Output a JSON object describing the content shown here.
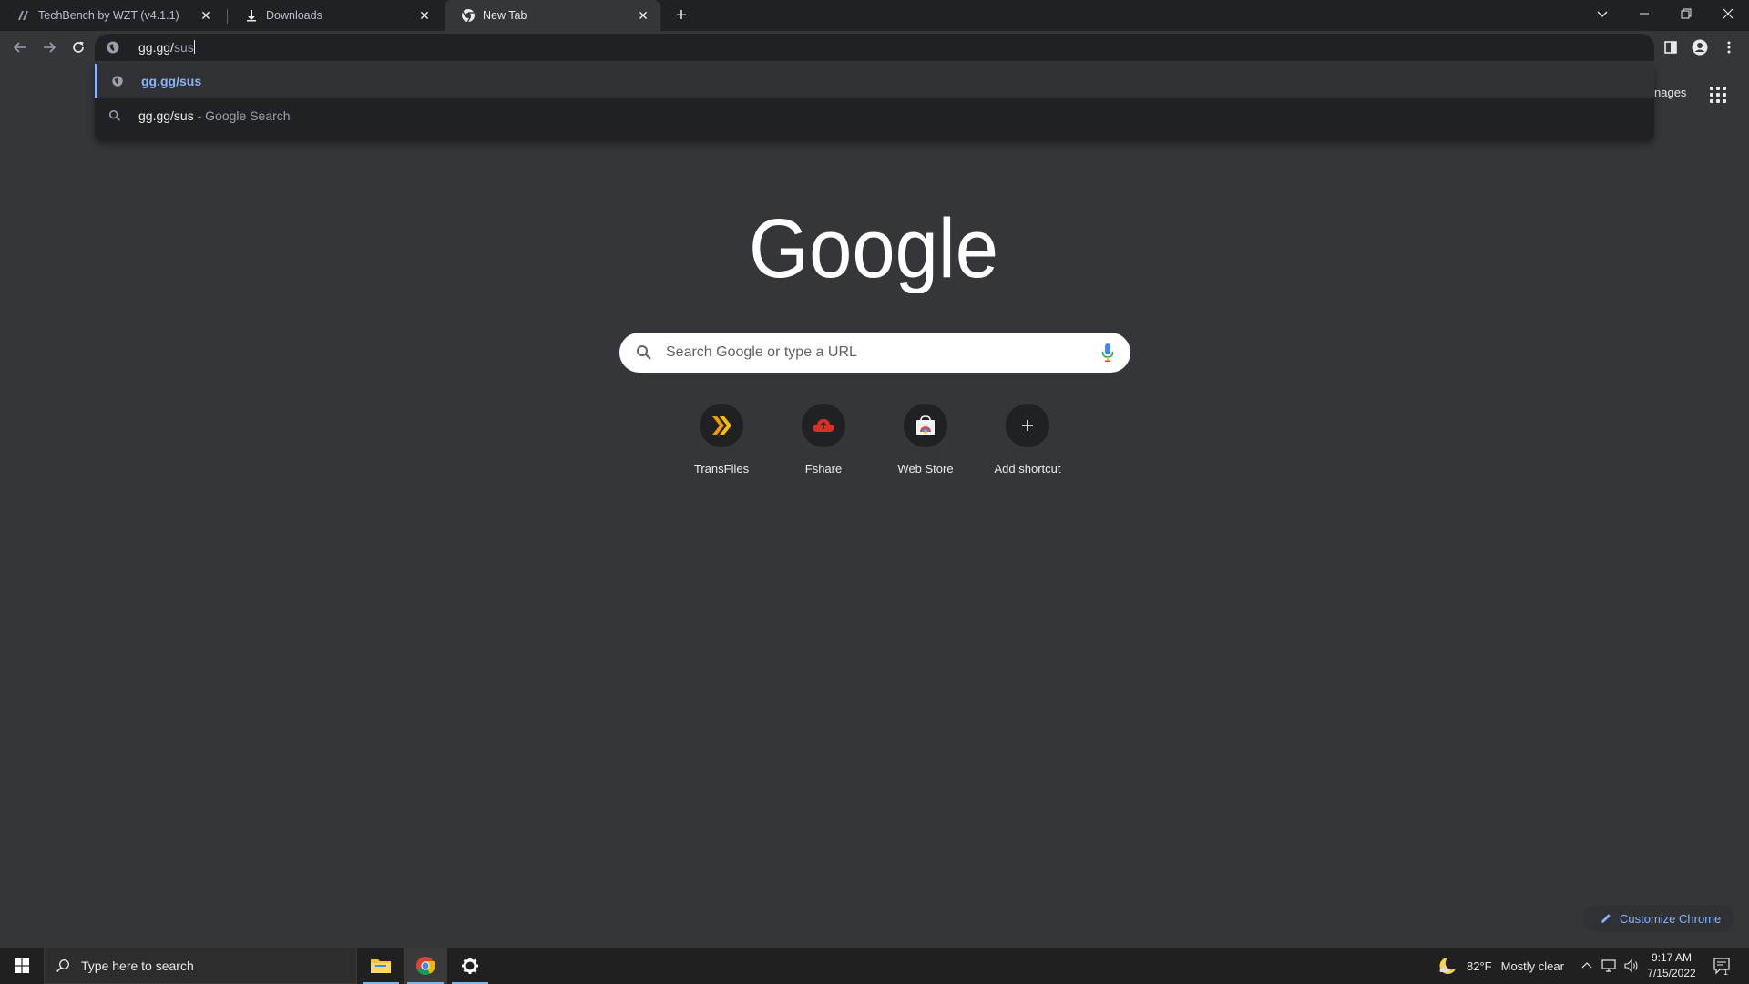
{
  "tabs": [
    {
      "label": "TechBench by WZT (v4.1.1)",
      "icon": "techbench-icon",
      "active": false
    },
    {
      "label": "Downloads",
      "icon": "download-icon",
      "active": false
    },
    {
      "label": "New Tab",
      "icon": "chrome-icon",
      "active": true
    }
  ],
  "omnibox": {
    "typed": "gg.gg/",
    "autocompleted": "sus"
  },
  "suggestions": [
    {
      "text": "gg.gg/sus",
      "suffix": "",
      "icon": "globe-icon",
      "selected": true
    },
    {
      "text": "gg.gg/sus",
      "suffix": " - Google Search",
      "icon": "search-icon",
      "selected": false
    }
  ],
  "header": {
    "images_link": "nages"
  },
  "search": {
    "placeholder": "Search Google or type a URL"
  },
  "shortcuts": [
    {
      "label": "TransFiles",
      "icon": "transfiles-icon"
    },
    {
      "label": "Fshare",
      "icon": "fshare-cloud-icon"
    },
    {
      "label": "Web Store",
      "icon": "web-store-icon"
    },
    {
      "label": "Add shortcut",
      "icon": "plus-icon"
    }
  ],
  "customize": {
    "label": "Customize Chrome"
  },
  "taskbar": {
    "search_placeholder": "Type here to search",
    "weather_temp": "82°F",
    "weather_text": "Mostly clear",
    "time": "9:17 AM",
    "date": "7/15/2022",
    "notification_count": "1"
  },
  "colors": {
    "accent": "#8ab4f8",
    "background": "#35363a",
    "frame": "#202124"
  }
}
